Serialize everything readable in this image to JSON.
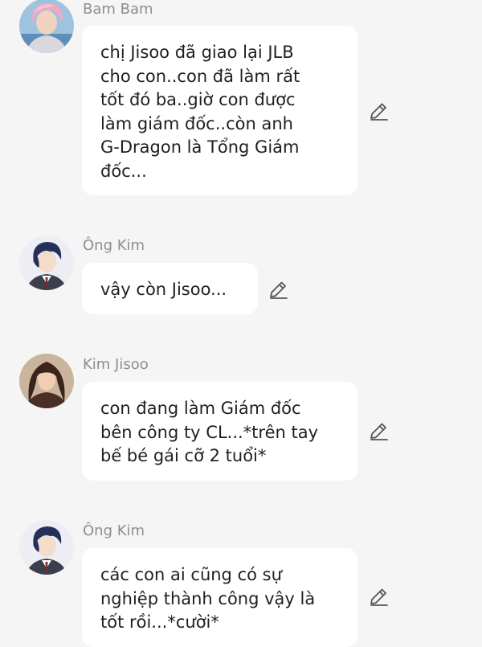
{
  "messages": [
    {
      "sender": "Bam Bam",
      "avatar": "pink-hair-avatar",
      "text": "chị Jisoo đã giao lại JLB\ncho con..con đã làm rất\ntốt đó ba..giờ con được\nlàm giám đốc..còn anh\nG-Dragon là Tổng Giám\nđốc...",
      "edit_icon": "pencil-icon"
    },
    {
      "sender": "Ông Kim",
      "avatar": "suit-man-avatar",
      "text": "vậy còn Jisoo...",
      "edit_icon": "pencil-icon"
    },
    {
      "sender": "Kim Jisoo",
      "avatar": "woman-avatar",
      "text": "con đang làm Giám đốc\nbên công ty CL...*trên tay\nbế bé gái cỡ 2 tuổi*",
      "edit_icon": "pencil-icon"
    },
    {
      "sender": "Ông Kim",
      "avatar": "suit-man-avatar",
      "text": "các con ai cũng có sự\nnghiệp thành công vậy là\ntốt rồi...*cười*",
      "edit_icon": "pencil-icon"
    }
  ],
  "colors": {
    "background": "#f5f5f5",
    "bubble": "#ffffff",
    "name": "#8e8e8e",
    "text": "#1f1f1f",
    "icon": "#555555"
  }
}
